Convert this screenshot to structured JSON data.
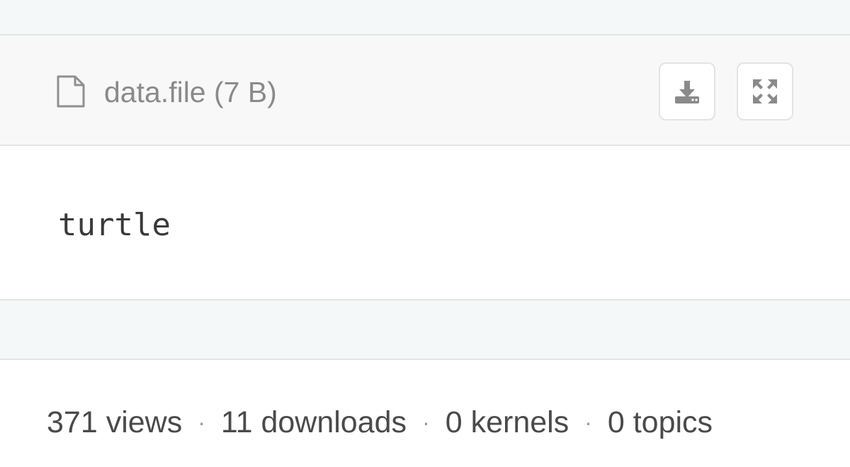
{
  "file": {
    "name": "data.file (7 B)",
    "content": "turtle"
  },
  "actions": {
    "download_icon": "download-icon",
    "expand_icon": "fullscreen-icon"
  },
  "stats": {
    "views": "371 views",
    "downloads": "11 downloads",
    "kernels": "0 kernels",
    "topics": "0 topics",
    "separator": "·"
  }
}
